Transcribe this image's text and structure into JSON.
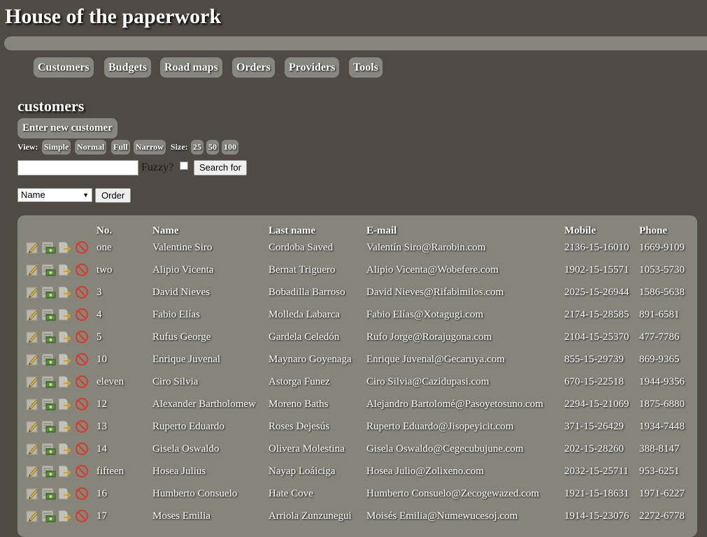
{
  "app": {
    "title": "House of the paperwork"
  },
  "nav": [
    {
      "label": "Customers"
    },
    {
      "label": "Budgets"
    },
    {
      "label": "Road maps"
    },
    {
      "label": "Orders"
    },
    {
      "label": "Providers"
    },
    {
      "label": "Tools"
    }
  ],
  "section": {
    "title": "customers",
    "enter_button": "Enter new customer"
  },
  "view": {
    "label": "View:",
    "options": [
      "Simple",
      "Normal",
      "Full",
      "Narrow"
    ],
    "size_label": "Size:",
    "sizes": [
      "25",
      "50",
      "100"
    ]
  },
  "search": {
    "value": "",
    "fuzzy_label": "Fuzzy?",
    "fuzzy_checked": false,
    "button": "Search for"
  },
  "order": {
    "selected": "Name",
    "button": "Order"
  },
  "table": {
    "columns": [
      "No.",
      "Name",
      "Last name",
      "E-mail",
      "Mobile",
      "Phone"
    ],
    "row_icons": [
      "edit-icon",
      "budget-icon",
      "export-icon",
      "delete-icon"
    ],
    "rows": [
      {
        "no": "one",
        "name": "Valentine Siro",
        "last_name": "Cordoba Saved",
        "email": "Valentín Siro@Rarobin.com",
        "mobile": "2136-15-16010",
        "phone": "1669-9109"
      },
      {
        "no": "two",
        "name": "Alipio Vicenta",
        "last_name": "Bernat Triguero",
        "email": "Alipio Vicenta@Wobefere.com",
        "mobile": "1902-15-15571",
        "phone": "1053-5730"
      },
      {
        "no": "3",
        "name": "David Nieves",
        "last_name": "Bobadilla Barroso",
        "email": "David Nieves@Rifabimilos.com",
        "mobile": "2025-15-26944",
        "phone": "1586-5638"
      },
      {
        "no": "4",
        "name": "Fabio Elías",
        "last_name": "Molleda Labarca",
        "email": "Fabio Elías@Xotagugi.com",
        "mobile": "2174-15-28585",
        "phone": "891-6581"
      },
      {
        "no": "5",
        "name": "Rufus George",
        "last_name": "Gardela Celedón",
        "email": "Rufo Jorge@Rorajugona.com",
        "mobile": "2104-15-25370",
        "phone": "477-7786"
      },
      {
        "no": "10",
        "name": "Enrique Juvenal",
        "last_name": "Maynaro Goyenaga",
        "email": "Enrique Juvenal@Gecaruya.com",
        "mobile": "855-15-29739",
        "phone": "869-9365"
      },
      {
        "no": "eleven",
        "name": "Ciro Silvia",
        "last_name": "Astorga Funez",
        "email": "Ciro Silvia@Cazidupasi.com",
        "mobile": "670-15-22518",
        "phone": "1944-9356"
      },
      {
        "no": "12",
        "name": "Alexander Bartholomew",
        "last_name": "Moreno Baths",
        "email": "Alejandro Bartolomé@Pasoyetosuno.com",
        "mobile": "2294-15-21069",
        "phone": "1875-6880"
      },
      {
        "no": "13",
        "name": "Ruperto Eduardo",
        "last_name": "Roses Dejesús",
        "email": "Ruperto Eduardo@Jisopeyicit.com",
        "mobile": "371-15-26429",
        "phone": "1934-7448"
      },
      {
        "no": "14",
        "name": "Gisela Oswaldo",
        "last_name": "Olivera Molestina",
        "email": "Gisela Oswaldo@Cegecubujune.com",
        "mobile": "202-15-28260",
        "phone": "388-8147"
      },
      {
        "no": "fifteen",
        "name": "Hosea Julius",
        "last_name": "Nayap Loáiciga",
        "email": "Hosea Julio@Zolixeno.com",
        "mobile": "2032-15-25711",
        "phone": "953-6251"
      },
      {
        "no": "16",
        "name": "Humberto Consuelo",
        "last_name": "Hate Cove",
        "email": "Humberto Consuelo@Zecogewazed.com",
        "mobile": "1921-15-18631",
        "phone": "1971-6227"
      },
      {
        "no": "17",
        "name": "Moses Emilia",
        "last_name": "Arriola Zunzunegui",
        "email": "Moisés Emilia@Numewucesoj.com",
        "mobile": "1914-15-23076",
        "phone": "2272-6778"
      }
    ]
  }
}
